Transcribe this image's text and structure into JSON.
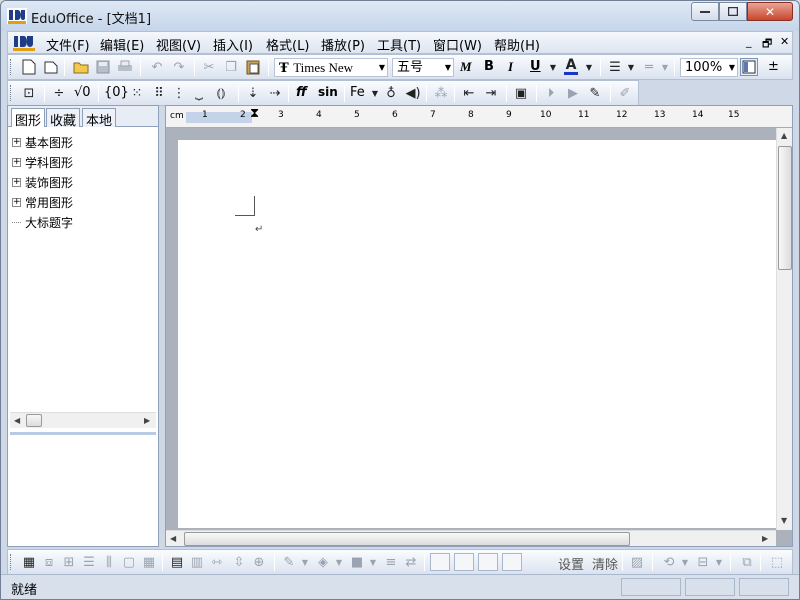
{
  "window": {
    "title": "EduOffice - [文档1]",
    "close_symbol": "✕"
  },
  "menubar": {
    "items": [
      "文件(F)",
      "编辑(E)",
      "视图(V)",
      "插入(I)",
      "格式(L)",
      "播放(P)",
      "工具(T)",
      "窗口(W)",
      "帮助(H)"
    ],
    "mdi": [
      "_",
      "🗗",
      "✕"
    ]
  },
  "toolbar1": {
    "font_name": "Times New",
    "font_size": "五号",
    "bold_label": "B",
    "italic_label": "I",
    "underline_label": "U",
    "font_color_label": "A",
    "zoom": "100%",
    "more_label": "±",
    "italic_m_label": "M"
  },
  "toolbar2": {
    "sqrt_label": "√0",
    "brace_label": "{0}",
    "ff_label": "ff",
    "sin_label": "sin",
    "fe_label": "Fe"
  },
  "left_panel": {
    "tabs": [
      "图形",
      "收藏",
      "本地"
    ],
    "tree": [
      {
        "label": "基本图形",
        "expandable": true
      },
      {
        "label": "学科图形",
        "expandable": true
      },
      {
        "label": "装饰图形",
        "expandable": true
      },
      {
        "label": "常用图形",
        "expandable": true
      },
      {
        "label": "大标题字",
        "expandable": false
      }
    ]
  },
  "ruler": {
    "unit": "cm",
    "ticks": [
      "1",
      "2",
      "3",
      "4",
      "5",
      "6",
      "7",
      "8",
      "9",
      "10",
      "11",
      "12",
      "13",
      "14",
      "15"
    ]
  },
  "document": {
    "paragraph_mark": "↵"
  },
  "toolbar3": {
    "settings_label": "设置",
    "clear_label": "清除"
  },
  "status": {
    "text": "就绪"
  },
  "colors": {
    "accent": "#1f3c88",
    "font_color_bar": "#1a37c4",
    "close_red": "#c9452d"
  }
}
